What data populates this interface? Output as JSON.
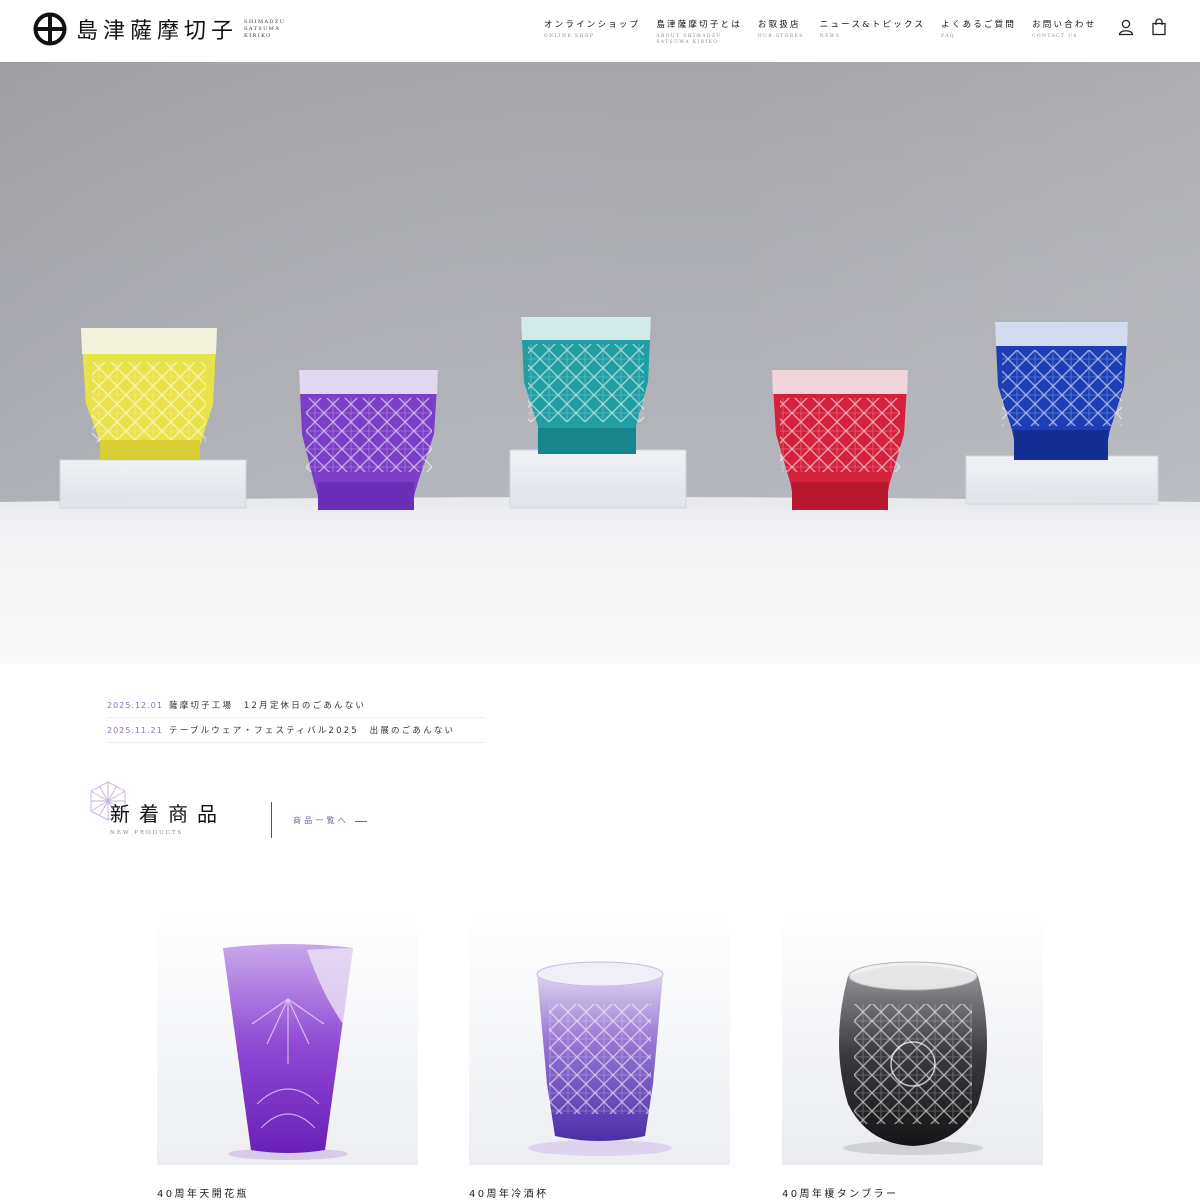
{
  "brand": {
    "name": "島津薩摩切子",
    "sub_lines": [
      "SHIMADZU",
      "SATSUMA",
      "KIRIKO"
    ]
  },
  "nav": [
    {
      "label": "オンラインショップ",
      "sub": "ONLINE SHOP"
    },
    {
      "label": "島津薩摩切子とは",
      "sub": "ABOUT SHIMADZU SATSUMA KIRIKO"
    },
    {
      "label": "お取扱店",
      "sub": "OUR STORES"
    },
    {
      "label": "ニュース&トピックス",
      "sub": "NEWS"
    },
    {
      "label": "よくあるご質問",
      "sub": "FAQ"
    },
    {
      "label": "お問い合わせ",
      "sub": "CONTACT US"
    }
  ],
  "header_icons": [
    "account-icon",
    "cart-icon"
  ],
  "hero": {
    "glasses": [
      "yellow",
      "purple",
      "teal",
      "red",
      "blue"
    ],
    "colors": {
      "yellow": "#e9e34a",
      "purple": "#7a3ec8",
      "teal": "#1f9ea4",
      "red": "#d4213c",
      "blue": "#1c3fb8"
    }
  },
  "news": [
    {
      "date": "2025.12.01",
      "title": "薩摩切子工場　12月定休日のごあんない"
    },
    {
      "date": "2025.11.21",
      "title": "テーブルウェア・フェスティバル2025　出展のごあんない"
    }
  ],
  "new_products": {
    "title": "新着商品",
    "subtitle": "NEW PRODUCTS",
    "link": "商品一覧へ"
  },
  "products": [
    {
      "name": "40周年天開花瓶",
      "color": "#7a2fc4"
    },
    {
      "name": "40周年冷酒杯",
      "color": "#5a3ab6"
    },
    {
      "name": "40周年榎タンブラー",
      "color": "#2b2b2b"
    }
  ],
  "accent_color": "#7d5ab0"
}
